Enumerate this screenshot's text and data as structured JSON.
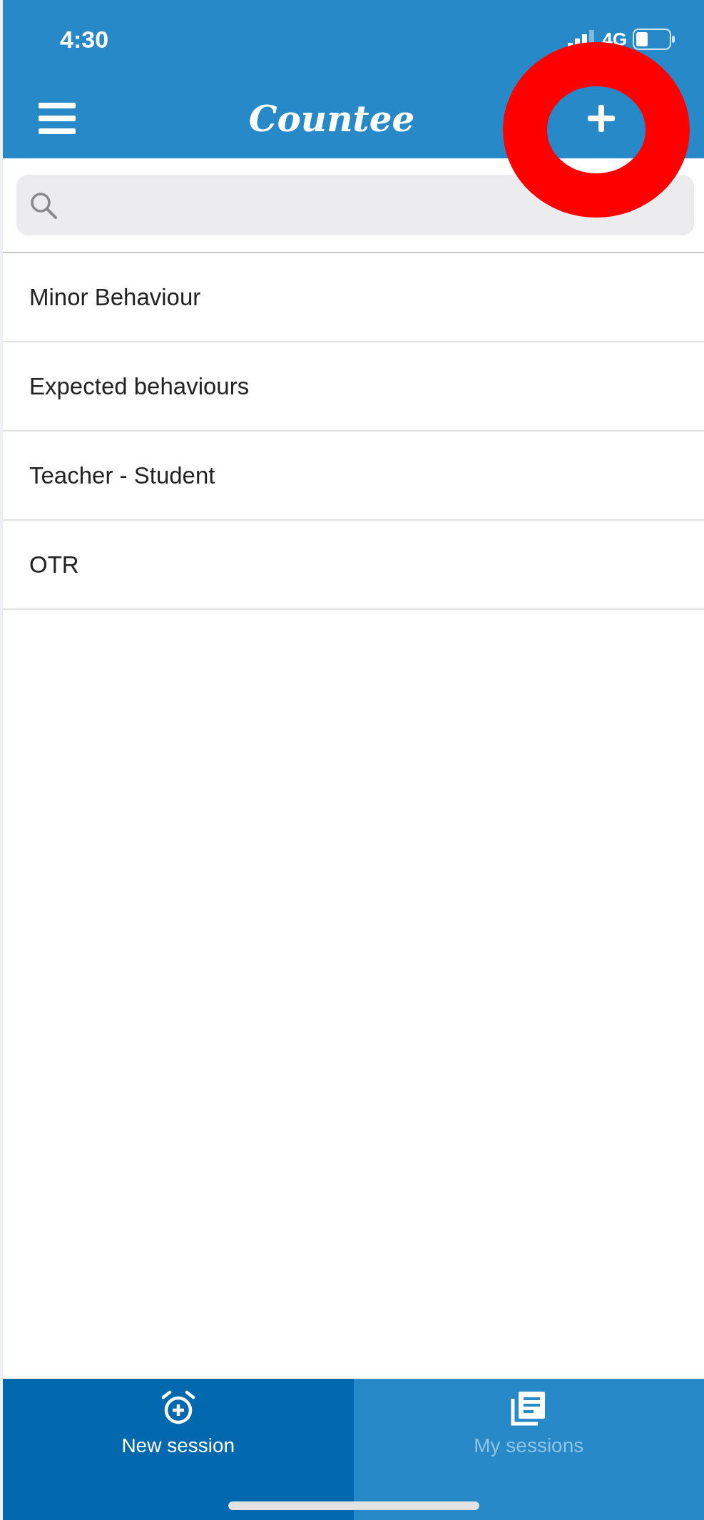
{
  "status_bar": {
    "time": "4:30",
    "network": "4G"
  },
  "header": {
    "title": "Countee"
  },
  "items": [
    {
      "label": "Minor Behaviour"
    },
    {
      "label": "Expected behaviours"
    },
    {
      "label": "Teacher - Student"
    },
    {
      "label": "OTR"
    }
  ],
  "tabs": [
    {
      "label": "New session",
      "selected": true
    },
    {
      "label": "My sessions",
      "selected": false
    }
  ]
}
